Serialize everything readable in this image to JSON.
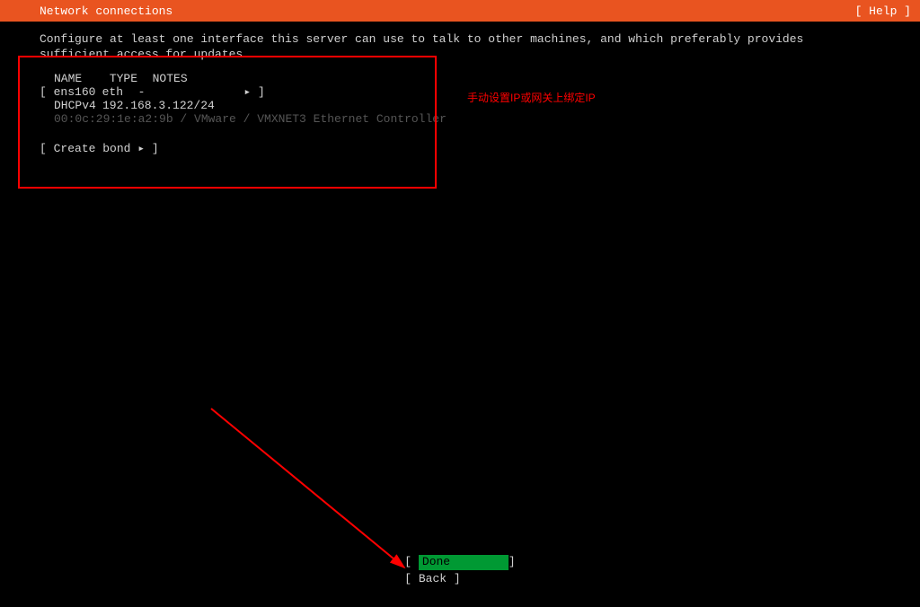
{
  "header": {
    "title": "Network connections",
    "help": "[ Help ]"
  },
  "description": "Configure at least one interface this server can use to talk to other machines, and which preferably provides sufficient access for updates.",
  "table": {
    "headers": {
      "name": "NAME",
      "type": "TYPE",
      "notes": "NOTES"
    },
    "interface": {
      "open": "[ ",
      "name": "ens160",
      "type": "eth",
      "notes": "-",
      "arrow": "▸",
      "close": " ]"
    },
    "dhcp": {
      "label": "DHCPv4",
      "ip": "192.168.3.122/24"
    },
    "mac": "00:0c:29:1e:a2:9b / VMware / VMXNET3 Ethernet Controller"
  },
  "createBond": {
    "open": "[ ",
    "label": "Create bond",
    "arrow": "▸",
    "close": " ]"
  },
  "annotation": "手动设置IP或网关上绑定IP",
  "footer": {
    "doneOpen": "[ ",
    "doneLabel": "Done",
    "doneClose": "]",
    "back": "[ Back        ]"
  }
}
